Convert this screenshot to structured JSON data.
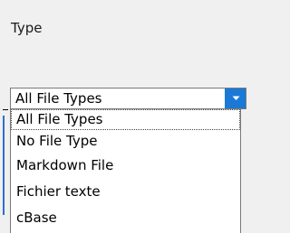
{
  "group": {
    "label": "Type"
  },
  "combo": {
    "selected_value": "All File Types",
    "button_icon": "chevron-down-icon",
    "accent_color": "#1a78d6"
  },
  "dropdown": {
    "items": [
      {
        "label": "All File Types",
        "selected": true
      },
      {
        "label": "No File Type",
        "selected": false
      },
      {
        "label": "Markdown File",
        "selected": false
      },
      {
        "label": "Fichier texte",
        "selected": false
      },
      {
        "label": "cBase",
        "selected": false
      }
    ]
  }
}
